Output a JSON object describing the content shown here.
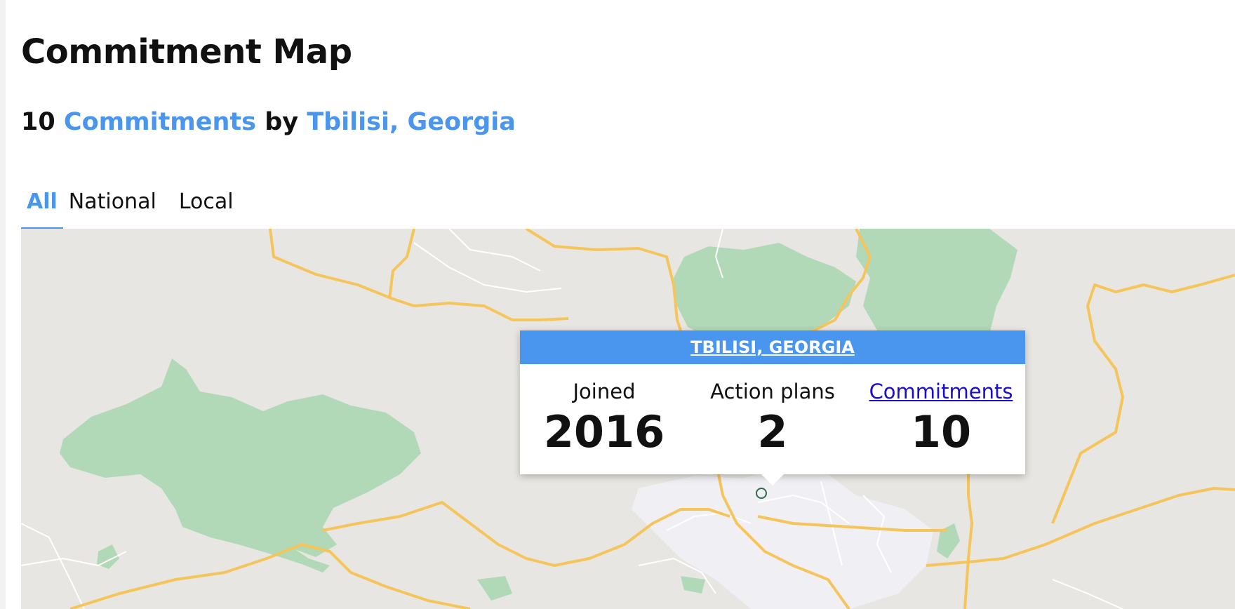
{
  "page": {
    "title": "Commitment Map"
  },
  "summary": {
    "count": "10",
    "commitments_link": "Commitments",
    "by_text": "by",
    "location_link": "Tbilisi, Georgia"
  },
  "tabs": [
    {
      "label": "All",
      "active": true
    },
    {
      "label": "National",
      "active": false
    },
    {
      "label": "Local",
      "active": false
    }
  ],
  "map": {
    "popup": {
      "title": "TBILISI, GEORGIA",
      "stats": [
        {
          "label": "Joined",
          "value": "2016",
          "is_link": false
        },
        {
          "label": "Action plans",
          "value": "2",
          "is_link": false
        },
        {
          "label": "Commitments",
          "value": "10",
          "is_link": true
        }
      ]
    },
    "colors": {
      "land": "#e8e6e2",
      "park": "#b2d9b7",
      "road_major": "#f5c55b",
      "road_minor": "#ffffff",
      "urban": "#f0f0f4",
      "accent": "#4a96ee"
    },
    "marker_icon": "map-pin-marker"
  }
}
